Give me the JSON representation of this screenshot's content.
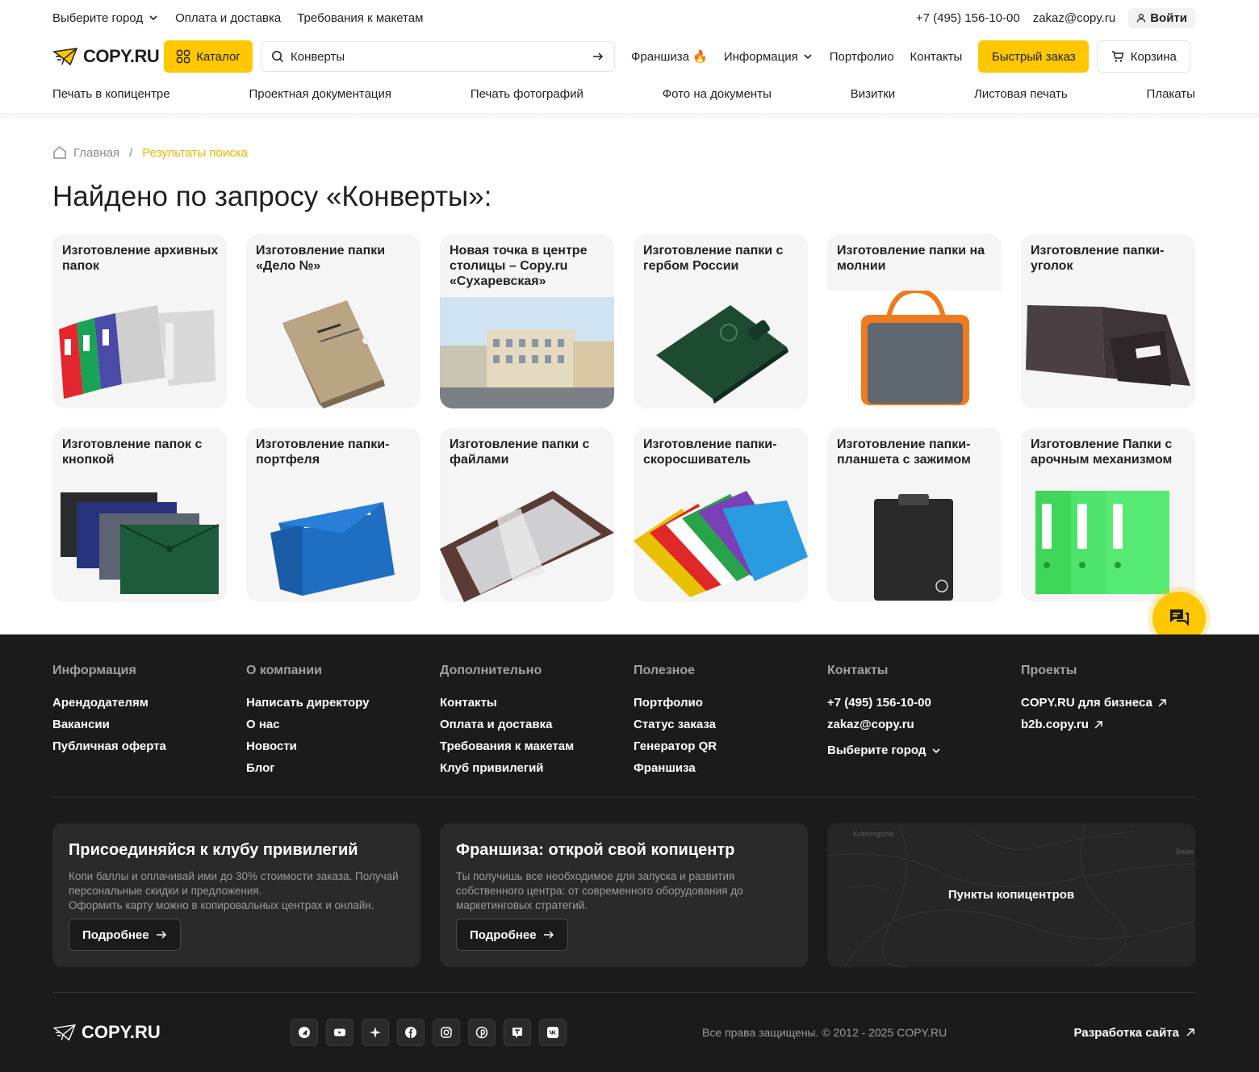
{
  "topbar": {
    "city": "Выберите город",
    "payment": "Оплата и доставка",
    "requirements": "Требования к макетам",
    "phone": "+7 (495) 156-10-00",
    "email": "zakaz@copy.ru",
    "login": "Войти"
  },
  "header": {
    "logo": "COPY.RU",
    "catalog": "Каталог",
    "search_value": "Конверты",
    "franchise": "Франшиза 🔥",
    "info": "Информация",
    "portfolio": "Портфолио",
    "contacts": "Контакты",
    "quick_order": "Быстрый заказ",
    "cart": "Корзина"
  },
  "catnav": [
    "Печать в копицентре",
    "Проектная документация",
    "Печать фотографий",
    "Фото на документы",
    "Визитки",
    "Листовая печать",
    "Плакаты"
  ],
  "breadcrumb": {
    "home": "Главная",
    "current": "Результаты поиска"
  },
  "page_title": "Найдено по запросу «Конверты»:",
  "cards": [
    "Изготовление архивных папок",
    "Изготовление папки «Дело №»",
    "Новая точка в центре столицы – Copy.ru «Сухаревская»",
    "Изготовление папки с гербом России",
    "Изготовление папки на молнии",
    "Изготовление папки-уголок",
    "Изготовление папок с кнопкой",
    "Изготовление папки-портфеля",
    "Изготовление папки с файлами",
    "Изготовление папки-скоросшиватель",
    "Изготовление папки-планшета с зажимом",
    "Изготовление Папки с арочным механизмом"
  ],
  "footer": {
    "columns": [
      {
        "title": "Информация",
        "links": [
          "Арендодателям",
          "Вакансии",
          "Публичная оферта"
        ]
      },
      {
        "title": "О компании",
        "links": [
          "Написать директору",
          "О нас",
          "Новости",
          "Блог"
        ]
      },
      {
        "title": "Дополнительно",
        "links": [
          "Контакты",
          "Оплата и доставка",
          "Требования к макетам",
          "Клуб привилегий"
        ]
      },
      {
        "title": "Полезное",
        "links": [
          "Портфолио",
          "Статус заказа",
          "Генератор QR",
          "Франшиза"
        ]
      },
      {
        "title": "Контакты",
        "links": [
          "+7 (495) 156-10-00",
          "zakaz@copy.ru",
          "Выберите город"
        ]
      },
      {
        "title": "Проекты",
        "links": [
          "COPY.RU для бизнеса",
          "b2b.copy.ru"
        ]
      }
    ],
    "promo_club": {
      "title": "Присоединяйся к клубу привилегий",
      "text": "Копи баллы и оплачивай ими до 30% стоимости заказа. Получай персональные скидки и предложения.",
      "text2": "Оформить карту можно в копировальных центрах и онлайн.",
      "button": "Подробнее"
    },
    "promo_franchise": {
      "title": "Франшиза: открой свой копицентр",
      "text": "Ты получишь все необходимое для запуска и развития собственного центра: от современного оборудования до маркетинговых стратегий.",
      "button": "Подробнее"
    },
    "map": {
      "label": "Пункты копицентров",
      "town1": "Krasnogorsk",
      "town2": "Balas"
    },
    "logo": "COPY.RU",
    "socials": [
      "telegram-icon",
      "youtube-icon",
      "sparkle-icon",
      "facebook-icon",
      "instagram-icon",
      "pinterest-icon",
      "tenchat-icon",
      "vk-icon"
    ],
    "copyright": "Все права защищены. © 2012 - 2025 COPY.RU",
    "dev": "Разработка сайта"
  },
  "colors": {
    "accent": "#ffc700",
    "footer_bg": "#1b1b1b",
    "breadcrumb_current": "#f0b400"
  }
}
